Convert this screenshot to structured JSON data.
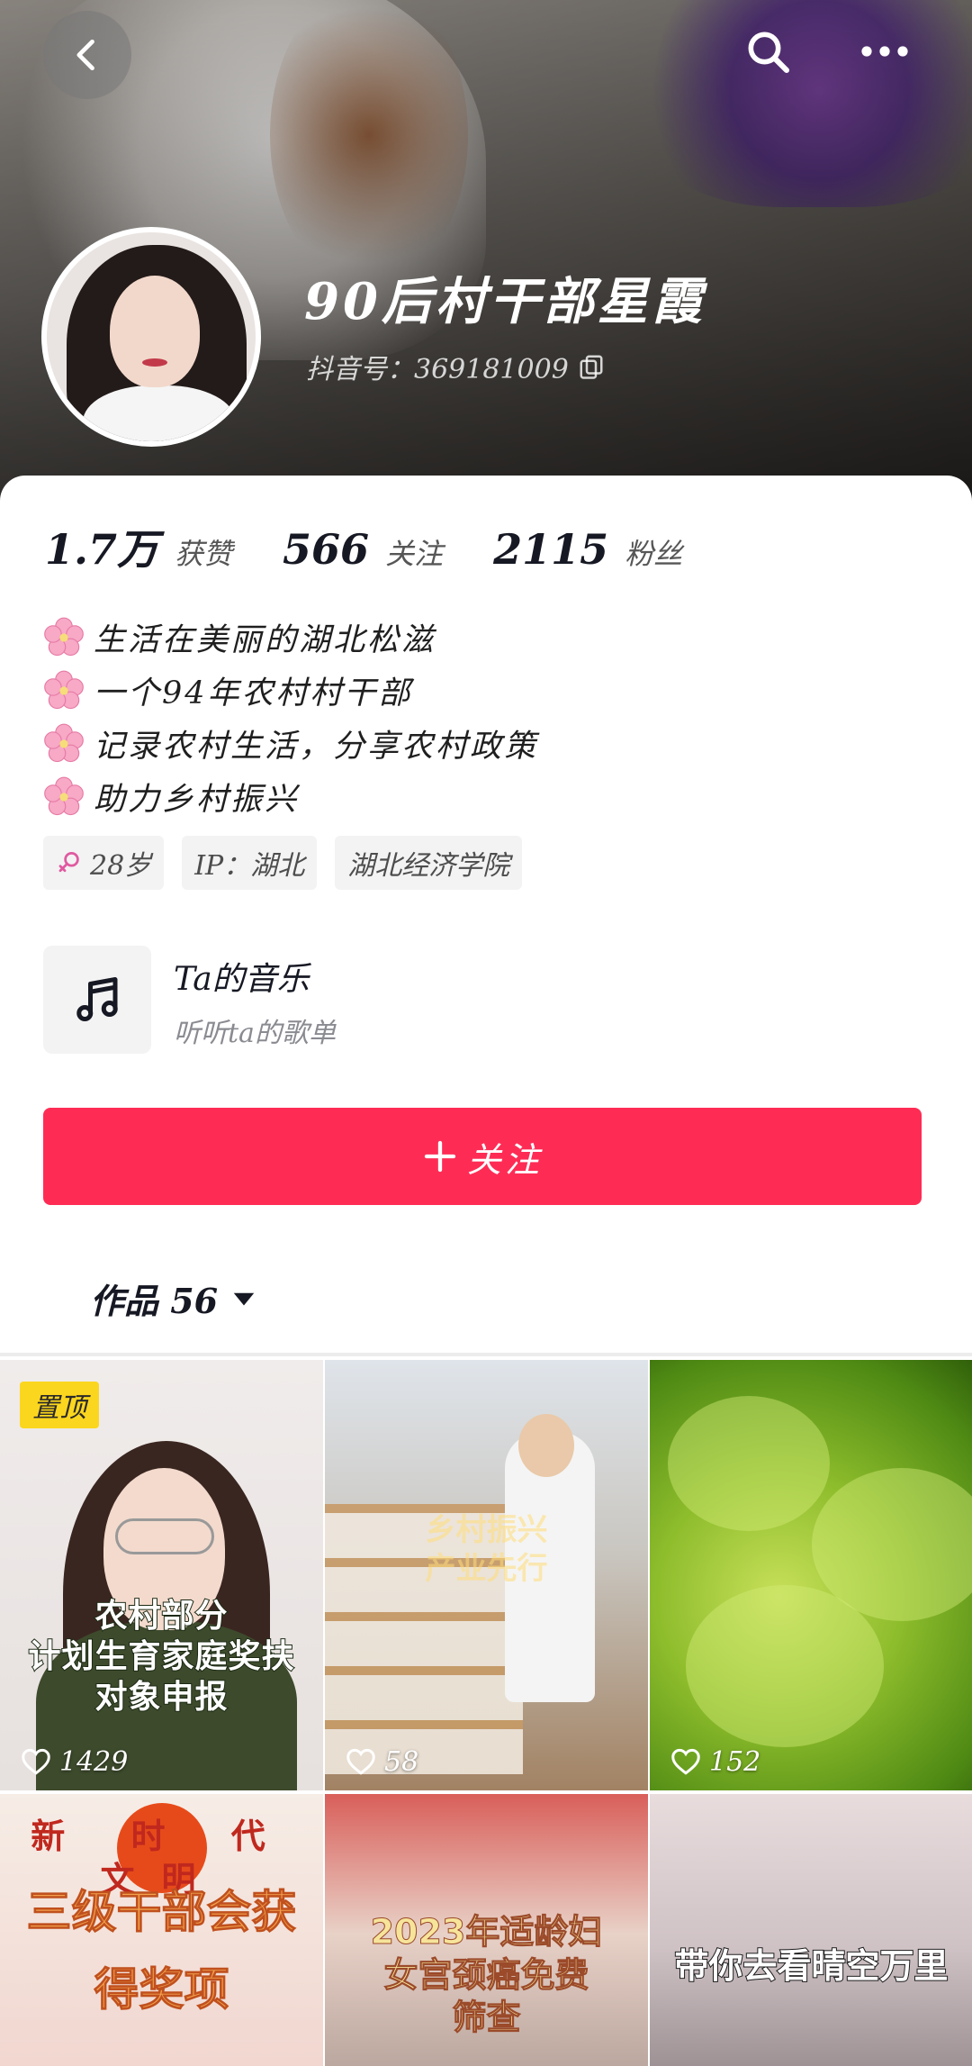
{
  "header": {
    "name": "90后村干部星霞",
    "uid_label": "抖音号：369181009"
  },
  "stats": [
    {
      "value": "1.7万",
      "label": "获赞"
    },
    {
      "value": "566",
      "label": "关注"
    },
    {
      "value": "2115",
      "label": "粉丝"
    }
  ],
  "bio": [
    "生活在美丽的湖北松滋",
    "一个94年农村村干部",
    "记录农村生活，分享农村政策",
    "助力乡村振兴"
  ],
  "tags": {
    "age": "28岁",
    "ip": "IP：湖北",
    "school": "湖北经济学院"
  },
  "music": {
    "title": "Ta的音乐",
    "subtitle": "听听ta的歌单"
  },
  "follow_button": {
    "label": "关注"
  },
  "works": {
    "tab_label": "作品 56"
  },
  "videos": [
    {
      "pinned": "置顶",
      "overlay": [
        "农村部分",
        "计划生育家庭奖扶",
        "对象申报"
      ],
      "likes": "1429"
    },
    {
      "overlay": [
        "乡村振兴",
        "产业先行"
      ],
      "likes": "58"
    },
    {
      "overlay": [],
      "likes": "152"
    },
    {
      "overlay": [
        "新 时 代   文明",
        "三级干部会获",
        "得奖项"
      ]
    },
    {
      "overlay": [
        "2023年适龄妇",
        "女宫颈癌免费",
        "筛查"
      ]
    },
    {
      "overlay": [
        "带你去看晴空万里"
      ]
    }
  ],
  "colors": {
    "accent": "#fe2c55",
    "pinned_badge": "#fbd61e"
  },
  "icons": {
    "back": "chevron-left-icon",
    "search": "search-icon",
    "more": "more-dots-icon",
    "copy": "copy-icon",
    "flower": "cherry-blossom-icon",
    "female": "female-icon",
    "music": "music-note-icon",
    "plus": "plus-icon",
    "dropdown": "triangle-down-icon",
    "heart": "heart-icon"
  }
}
